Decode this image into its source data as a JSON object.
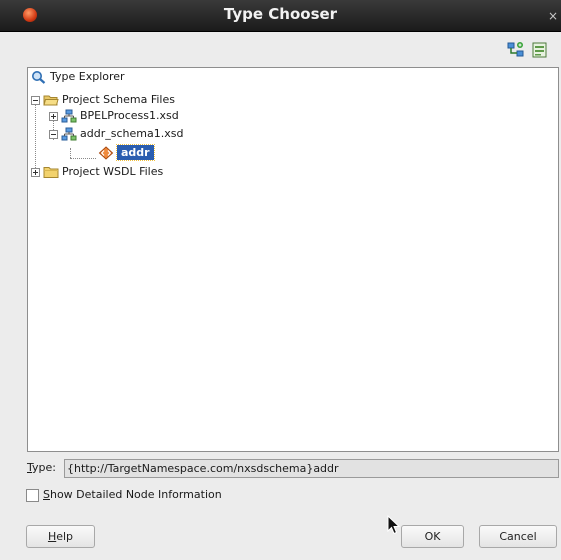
{
  "window": {
    "title": "Type Chooser",
    "close_glyph": "×"
  },
  "toolbar": {
    "icons": [
      "import-schema-icon",
      "browse-schema-icon"
    ]
  },
  "tree": {
    "root": {
      "label": "Type Explorer",
      "icon": "magnifier-icon"
    },
    "schema_folder": {
      "label": "Project Schema Files",
      "icon": "open-folder-icon",
      "expanded": true
    },
    "bpel_xsd": {
      "label": "BPELProcess1.xsd",
      "icon": "schema-icon",
      "expanded": false
    },
    "addr_xsd": {
      "label": "addr_schema1.xsd",
      "icon": "schema-icon",
      "expanded": true
    },
    "addr_element": {
      "label": "addr",
      "icon": "element-icon",
      "selected": true
    },
    "wsdl_folder": {
      "label": "Project WSDL Files",
      "icon": "closed-folder-icon",
      "expanded": false
    }
  },
  "type_field": {
    "mnemonic": "T",
    "label_rest": "ype:",
    "value": "{http://TargetNamespace.com/nxsdschema}addr"
  },
  "detail_checkbox": {
    "mnemonic": "S",
    "label_rest": "how Detailed Node Information",
    "checked": false
  },
  "buttons": {
    "help": {
      "mnemonic": "H",
      "label_rest": "elp"
    },
    "ok": {
      "label": "OK"
    },
    "cancel": {
      "label": "Cancel"
    }
  },
  "colors": {
    "selection": "#2a5db0",
    "titlebar": "#2b2b2b",
    "dialog_bg": "#ececec"
  }
}
